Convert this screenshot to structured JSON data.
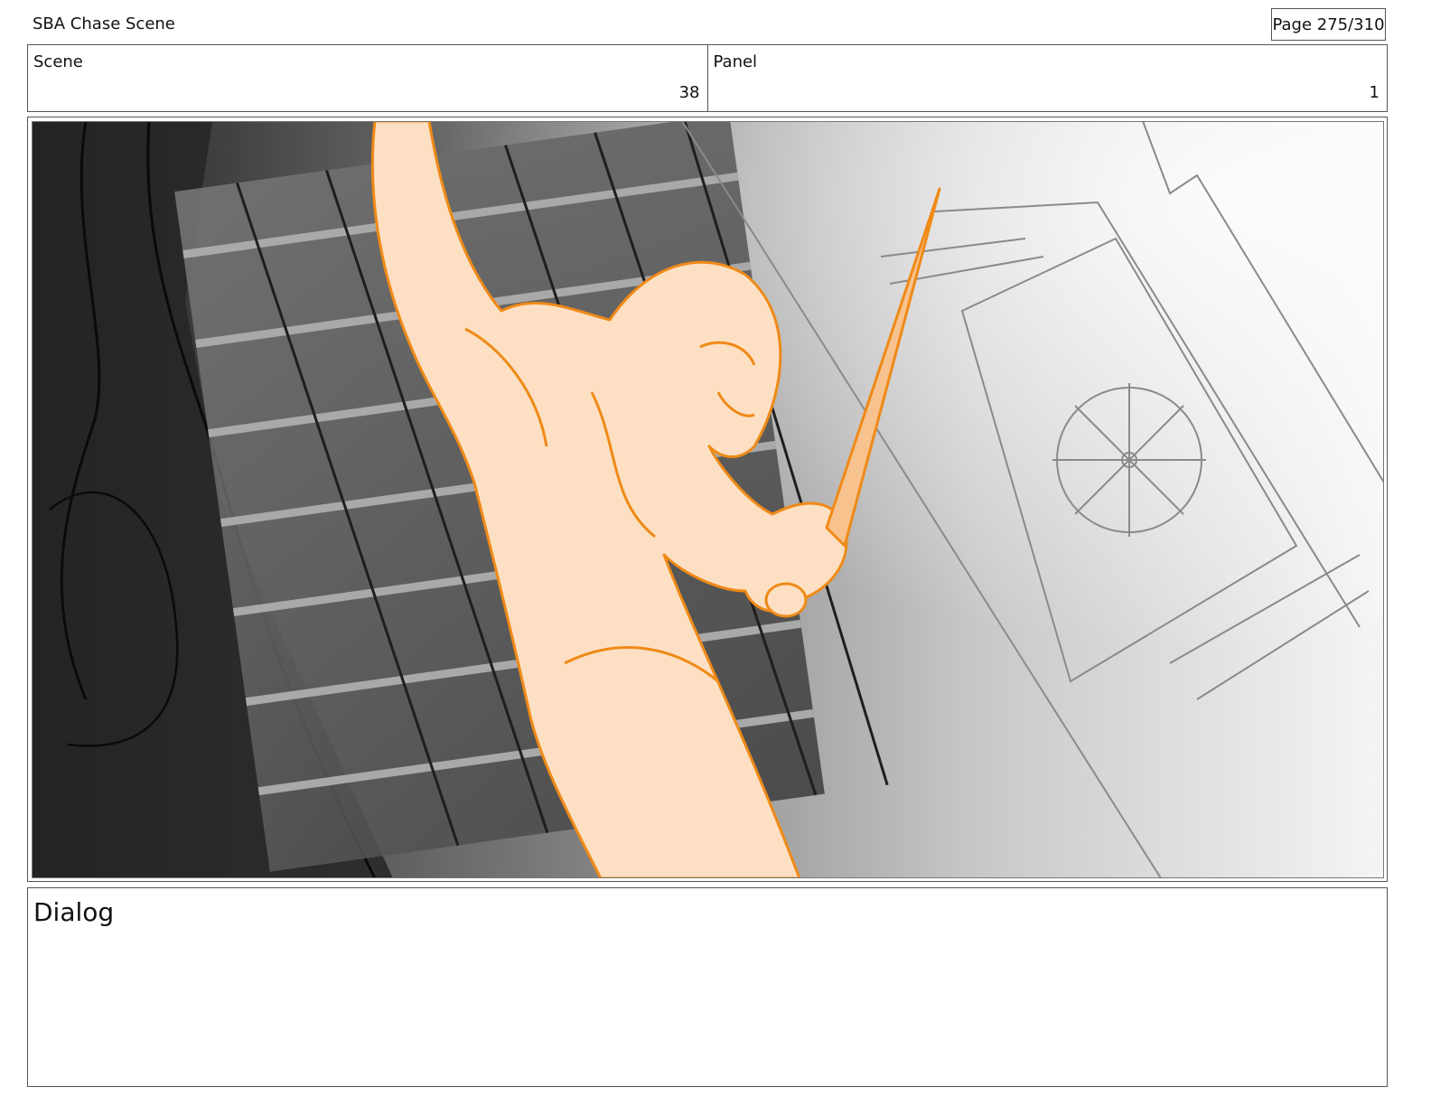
{
  "header": {
    "title": "SBA Chase Scene",
    "page": "Page 275/310"
  },
  "meta": {
    "scene_label": "Scene",
    "scene_value": "38",
    "panel_label": "Panel",
    "panel_value": "1"
  },
  "frame": {
    "description_colors": {
      "figure_fill": "#fde0c3",
      "figure_stroke": "#ef8a17",
      "background_dark": "#1f1f1f",
      "background_light": "#f2f2f2"
    }
  },
  "dialog": {
    "label": "Dialog"
  }
}
